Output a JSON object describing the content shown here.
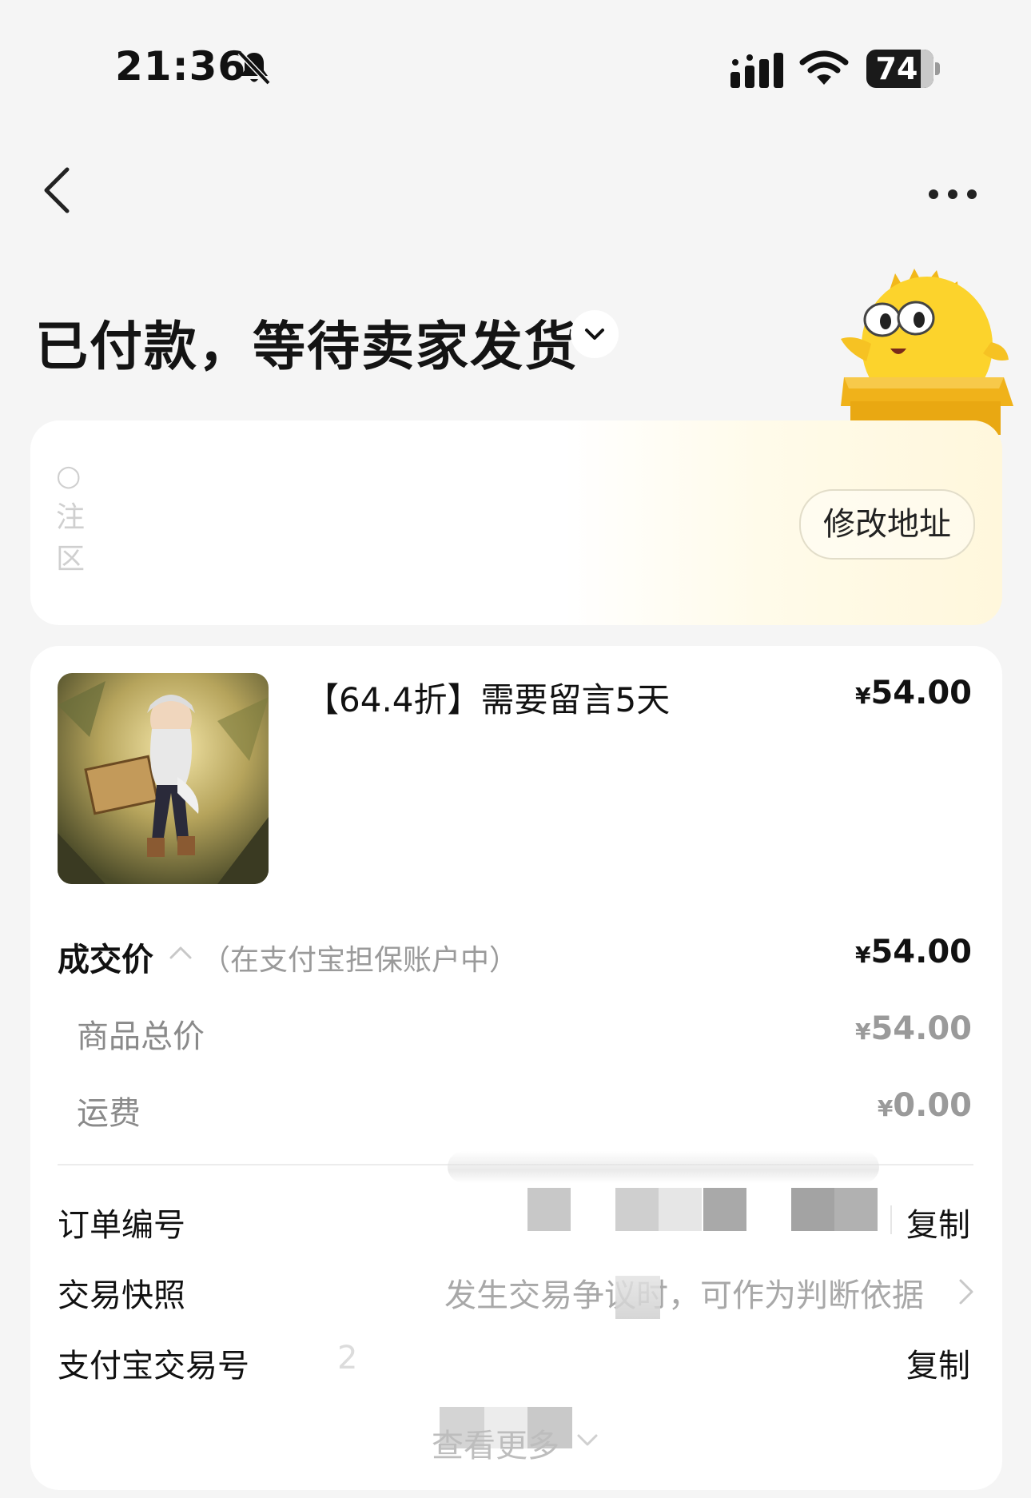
{
  "status_bar": {
    "time": "21:36",
    "battery": "74"
  },
  "header": {
    "title": "已付款，等待卖家发货"
  },
  "address": {
    "edit_label": "修改地址",
    "partial_chars": [
      "○",
      "注",
      "区"
    ]
  },
  "product": {
    "title": "【64.4折】需要留言5天",
    "price_symbol": "¥",
    "price": "54.00"
  },
  "pricing": {
    "deal_label": "成交价",
    "deal_note": "（在支付宝担保账户中）",
    "deal_price": "54.00",
    "items": [
      {
        "label": "商品总价",
        "value": "54.00"
      },
      {
        "label": "运费",
        "value": "0.00"
      }
    ]
  },
  "info_rows": {
    "order_no_label": "订单编号",
    "copy_label": "复制",
    "snapshot_label": "交易快照",
    "snapshot_hint": "发生交易争议时，可作为判断依据",
    "alipay_label": "支付宝交易号",
    "alipay_partial": "2",
    "see_more": "查看更多"
  }
}
